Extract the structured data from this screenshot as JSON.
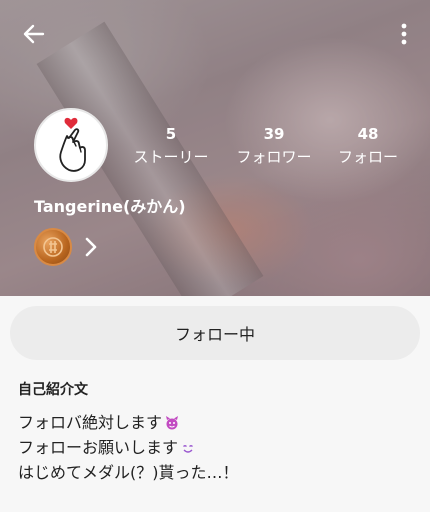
{
  "nav": {
    "back_icon": "arrow-left-icon",
    "more_icon": "more-vertical-icon"
  },
  "profile": {
    "avatar_icon": "heart-finger-icon",
    "username": "Tangerine(みかん)",
    "medal_icon": "medal-icon"
  },
  "stats": [
    {
      "value": "5",
      "label": "ストーリー"
    },
    {
      "value": "39",
      "label": "フォロワー"
    },
    {
      "value": "48",
      "label": "フォロー"
    }
  ],
  "follow_button": {
    "label": "フォロー中"
  },
  "bio": {
    "heading": "自己紹介文",
    "lines": [
      {
        "text": "フォロバ絶対します",
        "emoji": "devil-face-icon"
      },
      {
        "text": "フォローお願いします",
        "emoji": "smiling-face-icon"
      },
      {
        "text": "はじめてメダル(？)貰った…！"
      }
    ]
  },
  "colors": {
    "header_overlay": "#3a2e33",
    "button_bg": "#ececec",
    "heart_red": "#e02b3a",
    "medal_bronze": "#c2712a"
  }
}
